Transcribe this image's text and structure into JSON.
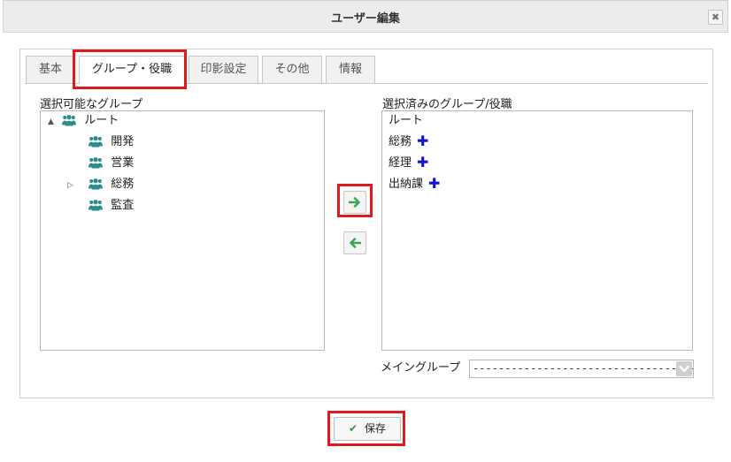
{
  "dialog": {
    "title": "ユーザー編集",
    "close_glyph": "✖"
  },
  "tabs": [
    {
      "label": "基本"
    },
    {
      "label": "グループ・役職",
      "active": true
    },
    {
      "label": "印影設定"
    },
    {
      "label": "その他"
    },
    {
      "label": "情報"
    }
  ],
  "available": {
    "label": "選択可能なグループ",
    "root": {
      "label": "ルート",
      "toggle": "▲"
    },
    "children": [
      {
        "label": "開発",
        "toggle": ""
      },
      {
        "label": "営業",
        "toggle": ""
      },
      {
        "label": "総務",
        "toggle": "▷"
      },
      {
        "label": "監査",
        "toggle": ""
      }
    ]
  },
  "selected": {
    "label": "選択済みのグループ/役職",
    "items": [
      {
        "label": "ルート",
        "plus": ""
      },
      {
        "label": "総務",
        "plus": "✚"
      },
      {
        "label": "経理",
        "plus": "✚"
      },
      {
        "label": "出納課",
        "plus": "✚"
      }
    ]
  },
  "main_group": {
    "label": "メイングループ",
    "value": "------------------------------------------"
  },
  "actions": {
    "save_label": "保存"
  },
  "colors": {
    "group_icon": "#2a8c8c",
    "arrow": "#3aa65a",
    "plus": "#1414d8",
    "highlight": "#e0191f"
  },
  "icons": {
    "group": "users-icon",
    "add": "arrow-right-icon",
    "remove": "arrow-left-icon",
    "plus": "plus-icon",
    "check": "check-icon"
  }
}
